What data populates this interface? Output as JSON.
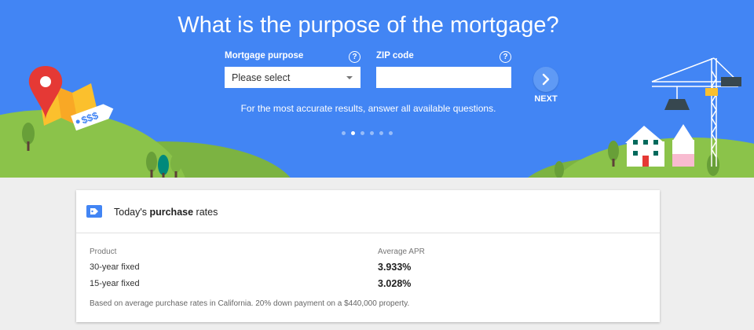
{
  "hero": {
    "title": "What is the purpose of the mortgage?",
    "purpose_label": "Mortgage purpose",
    "purpose_help": "?",
    "purpose_value": "Please select",
    "zip_label": "ZIP code",
    "zip_help": "?",
    "zip_value": "",
    "next_label": "NEXT",
    "hint": "For the most accurate results, answer all available questions.",
    "steps_total": 6,
    "step_active": 2,
    "price_tag": "$$$"
  },
  "rates": {
    "title_prefix": "Today's ",
    "title_bold": "purchase",
    "title_suffix": " rates",
    "col_product": "Product",
    "col_apr": "Average APR",
    "rows": [
      {
        "product": "30-year fixed",
        "apr": "3.933%"
      },
      {
        "product": "15-year fixed",
        "apr": "3.028%"
      }
    ],
    "footnote": "Based on average purchase rates in California. 20% down payment on a $440,000 property."
  },
  "colors": {
    "brand_blue": "#4285f4",
    "hill_green": "#8bc34a",
    "pin_red": "#e53935",
    "page_bg": "#eeeeee"
  },
  "icons": [
    "help-icon",
    "dropdown-arrow-icon",
    "chevron-right-icon",
    "tag-icon",
    "map-pin-icon",
    "crane-icon"
  ]
}
